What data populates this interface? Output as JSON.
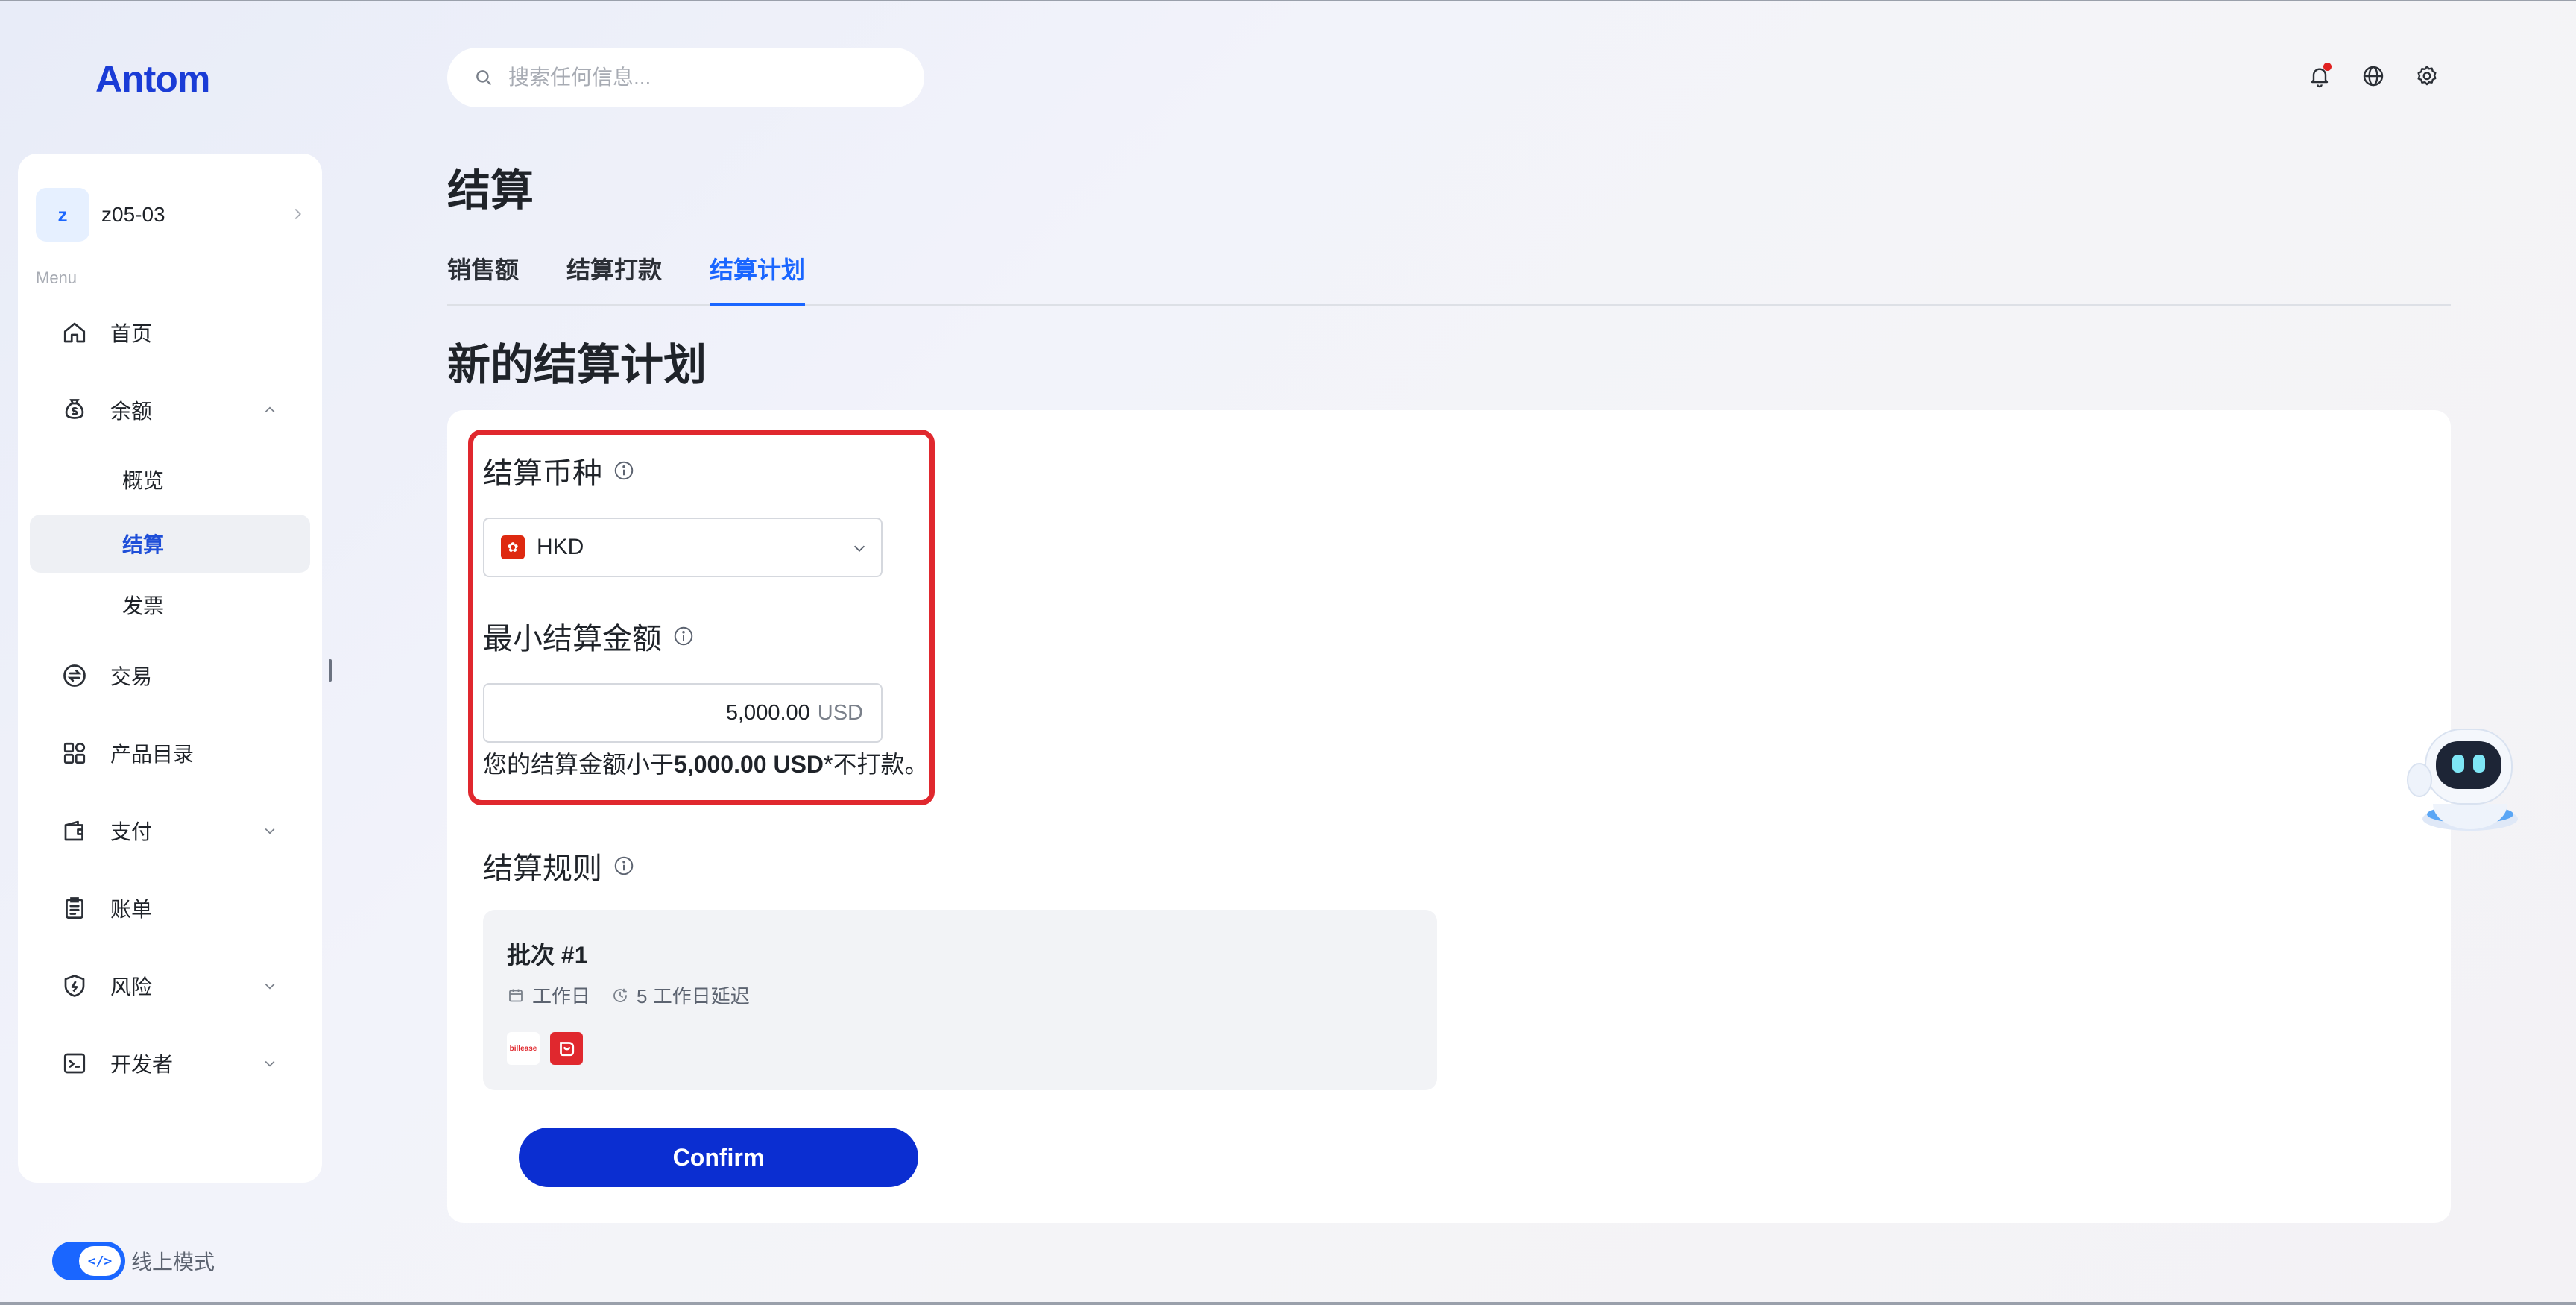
{
  "brand": {
    "logo_text": "Antom",
    "accent": "#1a66ff",
    "logo_color": "#1a3cd6"
  },
  "search": {
    "placeholder": "搜索任何信息..."
  },
  "topbar": {
    "icons": [
      "bell-icon",
      "globe-icon",
      "gear-icon"
    ]
  },
  "account": {
    "initial": "z",
    "name": "z05-03"
  },
  "sidebar": {
    "menu_label": "Menu",
    "items": [
      {
        "label": "首页",
        "icon": "home-icon"
      },
      {
        "label": "余额",
        "icon": "money-bag-icon",
        "expanded": true,
        "children": [
          {
            "label": "概览"
          },
          {
            "label": "结算",
            "active": true
          },
          {
            "label": "发票"
          }
        ]
      },
      {
        "label": "交易",
        "icon": "exchange-icon"
      },
      {
        "label": "产品目录",
        "icon": "grid-icon"
      },
      {
        "label": "支付",
        "icon": "wallet-icon",
        "expandable": true
      },
      {
        "label": "账单",
        "icon": "clipboard-icon"
      },
      {
        "label": "风险",
        "icon": "shield-icon",
        "expandable": true
      },
      {
        "label": "开发者",
        "icon": "terminal-icon",
        "expandable": true
      }
    ]
  },
  "mode": {
    "label": "线上模式",
    "toggle_glyph": "</>",
    "on": true
  },
  "page": {
    "title": "结算",
    "tabs": [
      {
        "label": "销售额"
      },
      {
        "label": "结算打款"
      },
      {
        "label": "结算计划",
        "active": true
      }
    ],
    "section_title": "新的结算计划"
  },
  "form": {
    "currency_label": "结算币种",
    "currency_value": "HKD",
    "min_amount_label": "最小结算金额",
    "min_amount_value": "5,000.00",
    "min_amount_unit": "USD",
    "hint_prefix": "您的结算金额小于",
    "hint_amount": "5,000.00 USD",
    "hint_suffix": "*不打款。",
    "rules_label": "结算规则"
  },
  "rule": {
    "batch_title": "批次 #1",
    "day_type": "工作日",
    "delay": "5 工作日延迟",
    "logo_text": "billease"
  },
  "actions": {
    "confirm_label": "Confirm"
  }
}
